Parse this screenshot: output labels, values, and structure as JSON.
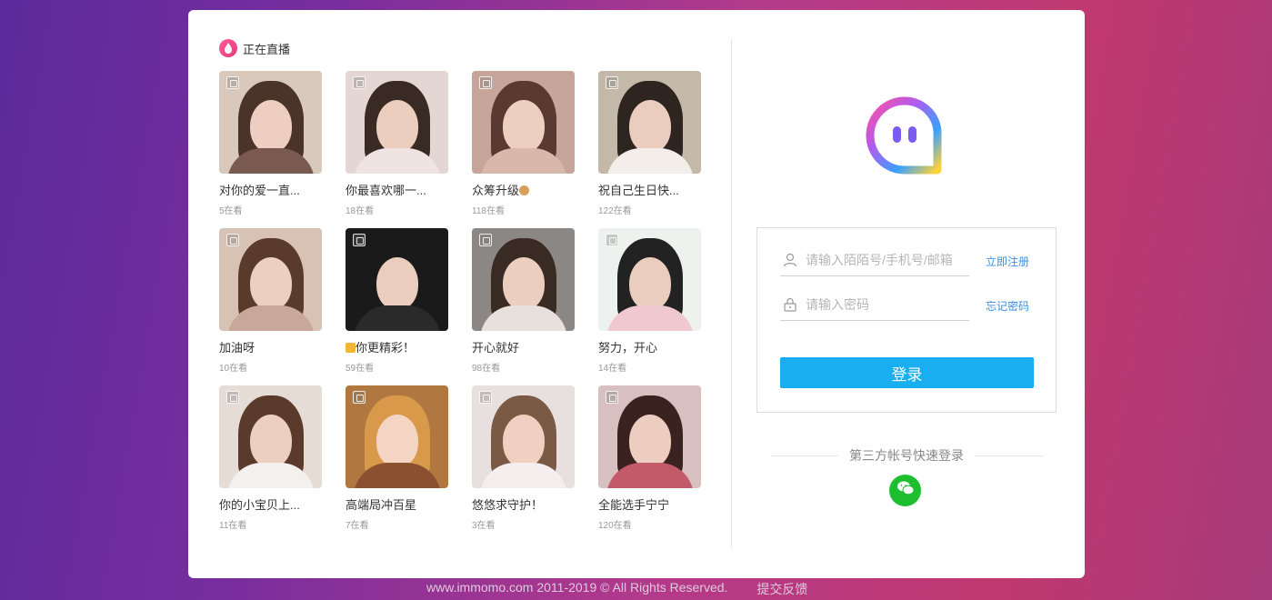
{
  "live": {
    "title": "正在直播",
    "items": [
      {
        "title": "对你的爱一直...",
        "viewers": "5在看",
        "palette": {
          "bg": "#d9c9bd",
          "hair": "#4a3328",
          "body": "#7a5a50"
        }
      },
      {
        "title": "你最喜欢哪一...",
        "viewers": "18在看",
        "palette": {
          "bg": "#e4d6d2",
          "hair": "#3a2a24",
          "body": "#f0e4e2"
        }
      },
      {
        "title": "众筹升级",
        "title_emoji": "monkey-emoji",
        "viewers": "118在看",
        "palette": {
          "bg": "#c7a59a",
          "hair": "#5a3a30",
          "body": "#d8b8aa"
        }
      },
      {
        "title": "祝自己生日快...",
        "viewers": "122在看",
        "palette": {
          "bg": "#c4b8a8",
          "hair": "#2e2420",
          "body": "#f4eeea"
        }
      },
      {
        "title": "加油呀",
        "viewers": "10在看",
        "palette": {
          "bg": "#d8c2b4",
          "hair": "#5a3a2a",
          "body": "#c8a898"
        }
      },
      {
        "title": "你更精彩！",
        "title_emoji": "badge-emoji",
        "viewers": "59在看",
        "palette": {
          "bg": "#1a1a1a",
          "hair": "#1a1a1a",
          "body": "#2a2a2a"
        }
      },
      {
        "title": "开心就好",
        "viewers": "98在看",
        "palette": {
          "bg": "#8a8784",
          "hair": "#3a2a24",
          "body": "#e8e0dc"
        }
      },
      {
        "title": "努力，开心",
        "viewers": "14在看",
        "palette": {
          "bg": "#eef2ee",
          "hair": "#222222",
          "body": "#f0c8d0"
        }
      },
      {
        "title": "你的小宝贝上...",
        "viewers": "11在看",
        "palette": {
          "bg": "#e6dcd6",
          "hair": "#5a3a2a",
          "body": "#f4f0ee"
        }
      },
      {
        "title": "高端局冲百星",
        "viewers": "7在看",
        "palette": {
          "bg": "#b07840",
          "hair": "#d89a4a",
          "body": "#8a5030"
        }
      },
      {
        "title": "悠悠求守护！",
        "viewers": "3在看",
        "palette": {
          "bg": "#e8e0de",
          "hair": "#7a5a44",
          "body": "#f6eeee"
        }
      },
      {
        "title": "全能选手宁宁",
        "viewers": "120在看",
        "palette": {
          "bg": "#d8c0c0",
          "hair": "#3a2220",
          "body": "#c25a6a"
        }
      }
    ]
  },
  "login": {
    "account_placeholder": "请输入陌陌号/手机号/邮箱",
    "password_placeholder": "请输入密码",
    "register_label": "立即注册",
    "forgot_label": "忘记密码",
    "submit_label": "登录",
    "third_party_label": "第三方帐号快速登录"
  },
  "footer": {
    "copyright": "www.immomo.com 2011-2019 © All Rights Reserved.",
    "feedback": "提交反馈"
  },
  "colors": {
    "accent": "#18aef0",
    "link": "#3a8ee6",
    "wechat": "#1dbf30",
    "live_icon": "#e23b7a"
  }
}
